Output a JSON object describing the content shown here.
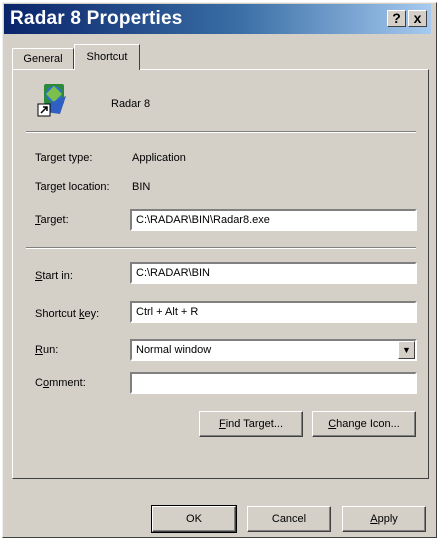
{
  "window": {
    "title": "Radar 8 Properties",
    "help_label": "?",
    "close_label": "x"
  },
  "tabs": [
    {
      "label": "General"
    },
    {
      "label": "Shortcut"
    }
  ],
  "app": {
    "name": "Radar 8",
    "icon": "shortcut-app-icon"
  },
  "info": {
    "target_type_label": "Target type:",
    "target_type_value": "Application",
    "target_location_label": "Target location:",
    "target_location_value": "BIN"
  },
  "fields": {
    "target": {
      "label_u": "T",
      "label_rest": "arget:",
      "value": "C:\\RADAR\\BIN\\Radar8.exe"
    },
    "start_in": {
      "label_u": "S",
      "label_rest": "tart in:",
      "value": "C:\\RADAR\\BIN"
    },
    "shortcut_key": {
      "label_pre": "Shortcut ",
      "label_u": "k",
      "label_rest": "ey:",
      "value": "Ctrl + Alt + R"
    },
    "run": {
      "label_u": "R",
      "label_rest": "un:",
      "value": "Normal window"
    },
    "comment": {
      "label_pre": "C",
      "label_u": "o",
      "label_rest": "mment:",
      "value": ""
    }
  },
  "buttons": {
    "find_target": {
      "u": "F",
      "rest": "ind Target..."
    },
    "change_icon": {
      "u": "C",
      "rest": "hange Icon..."
    },
    "ok": {
      "label": "OK"
    },
    "cancel": {
      "label": "Cancel"
    },
    "apply": {
      "u": "A",
      "rest": "pply"
    }
  }
}
